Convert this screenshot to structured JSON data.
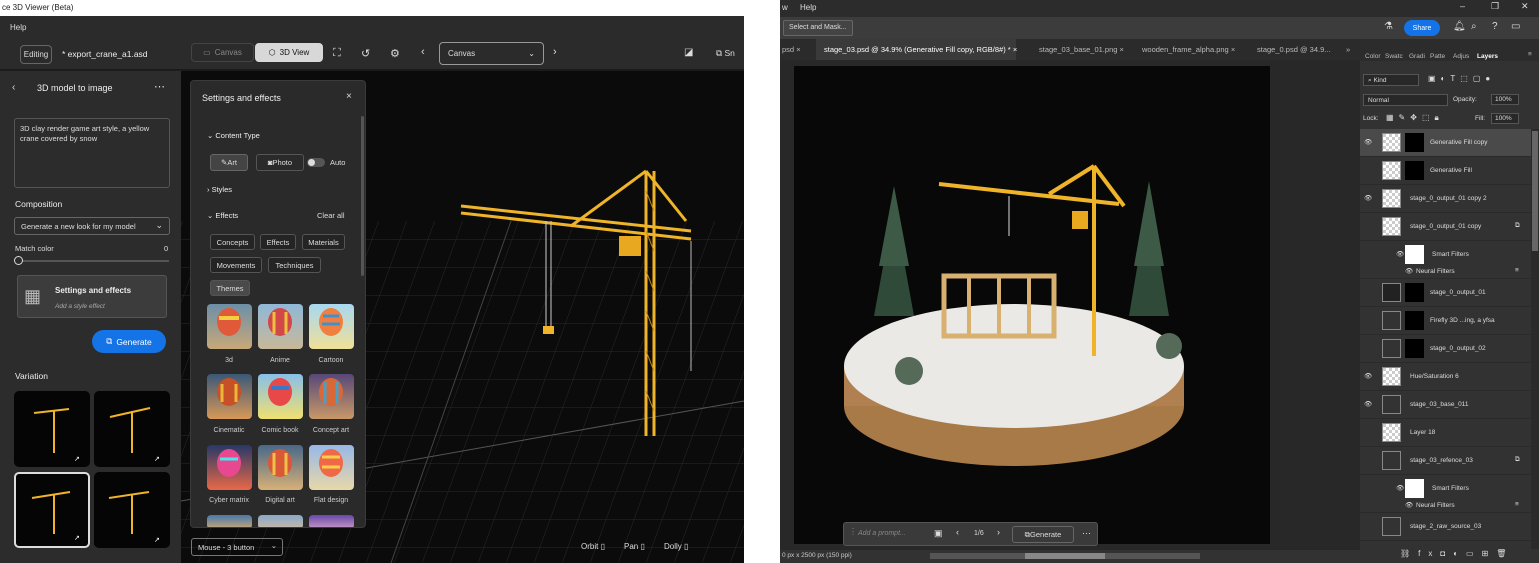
{
  "left_app": {
    "title": "ce 3D Viewer (Beta)",
    "menu_help": "Help",
    "editing_label": "Editing",
    "filename": "* export_crane_a1.asd",
    "canvas_button": "Canvas",
    "view3d_button": "3D View",
    "canvas_select": "Canvas",
    "snap_label": "Sn",
    "panel": {
      "title": "3D model to image",
      "prompt": "3D clay render game art style, a yellow crane covered by snow",
      "composition_label": "Composition",
      "composition_value": "Generate a new look for my model",
      "match_color_label": "Match color",
      "match_color_value": "0",
      "settings_title": "Settings and effects",
      "settings_subtitle": "Add a style effect",
      "generate_label": "Generate",
      "variation_label": "Variation"
    },
    "effects_panel": {
      "title": "Settings and effects",
      "content_type_label": "Content Type",
      "art_label": "Art",
      "photo_label": "Photo",
      "auto_label": "Auto",
      "styles_label": "Styles",
      "effects_label": "Effects",
      "clear_all": "Clear all",
      "tags": [
        "Concepts",
        "Effects",
        "Materials",
        "Movements",
        "Techniques",
        "Themes"
      ],
      "styles": [
        "3d",
        "Anime",
        "Cartoon",
        "Cinematic",
        "Comic book",
        "Concept art",
        "Cyber matrix",
        "Digital art",
        "Flat design"
      ]
    },
    "bottom": {
      "mouse_select": "Mouse - 3 button",
      "orbit": "Orbit",
      "pan": "Pan",
      "dolly": "Dolly"
    }
  },
  "right_app": {
    "menu_items": [
      "w",
      "Help"
    ],
    "select_mask": "Select and Mask...",
    "share_label": "Share",
    "tabs": [
      "psd",
      "stage_03.psd @ 34.9% (Generative Fill copy, RGB/8#) *",
      "stage_03_base_01.png",
      "wooden_frame_alpha.png",
      "stage_0.psd @ 34.9..."
    ],
    "panel_tabs": [
      "Color",
      "Swatc",
      "Gradi",
      "Patte",
      "Adjus",
      "Layers"
    ],
    "kind_label": "Kind",
    "blend_mode": "Normal",
    "opacity_label": "Opacity:",
    "opacity_value": "100%",
    "lock_label": "Lock:",
    "fill_label": "Fill:",
    "fill_value": "100%",
    "layers": [
      {
        "name": "Generative Fill copy"
      },
      {
        "name": "Generative Fill"
      },
      {
        "name": "stage_0_output_01 copy 2"
      },
      {
        "name": "stage_0_output_01 copy"
      },
      {
        "name": "Smart Filters"
      },
      {
        "name": "Neural Filters"
      },
      {
        "name": "stage_0_output_01"
      },
      {
        "name": "Firefly 3D ...ing, a yfsa"
      },
      {
        "name": "stage_0_output_02"
      },
      {
        "name": "Hue/Saturation 6"
      },
      {
        "name": "stage_03_base_011"
      },
      {
        "name": "Layer 18"
      },
      {
        "name": "stage_03_refence_03"
      },
      {
        "name": "Smart Filters"
      },
      {
        "name": "Neural Filters"
      },
      {
        "name": "stage_2_raw_source_03"
      }
    ],
    "prompt_placeholder": "Add a prompt...",
    "pager": "1/6",
    "generate_label": "Generate",
    "status": "0 px x 2500 px (150 ppi)"
  },
  "colors": {
    "accent_blue": "#1473e6",
    "crane_yellow": "#f0b428"
  }
}
